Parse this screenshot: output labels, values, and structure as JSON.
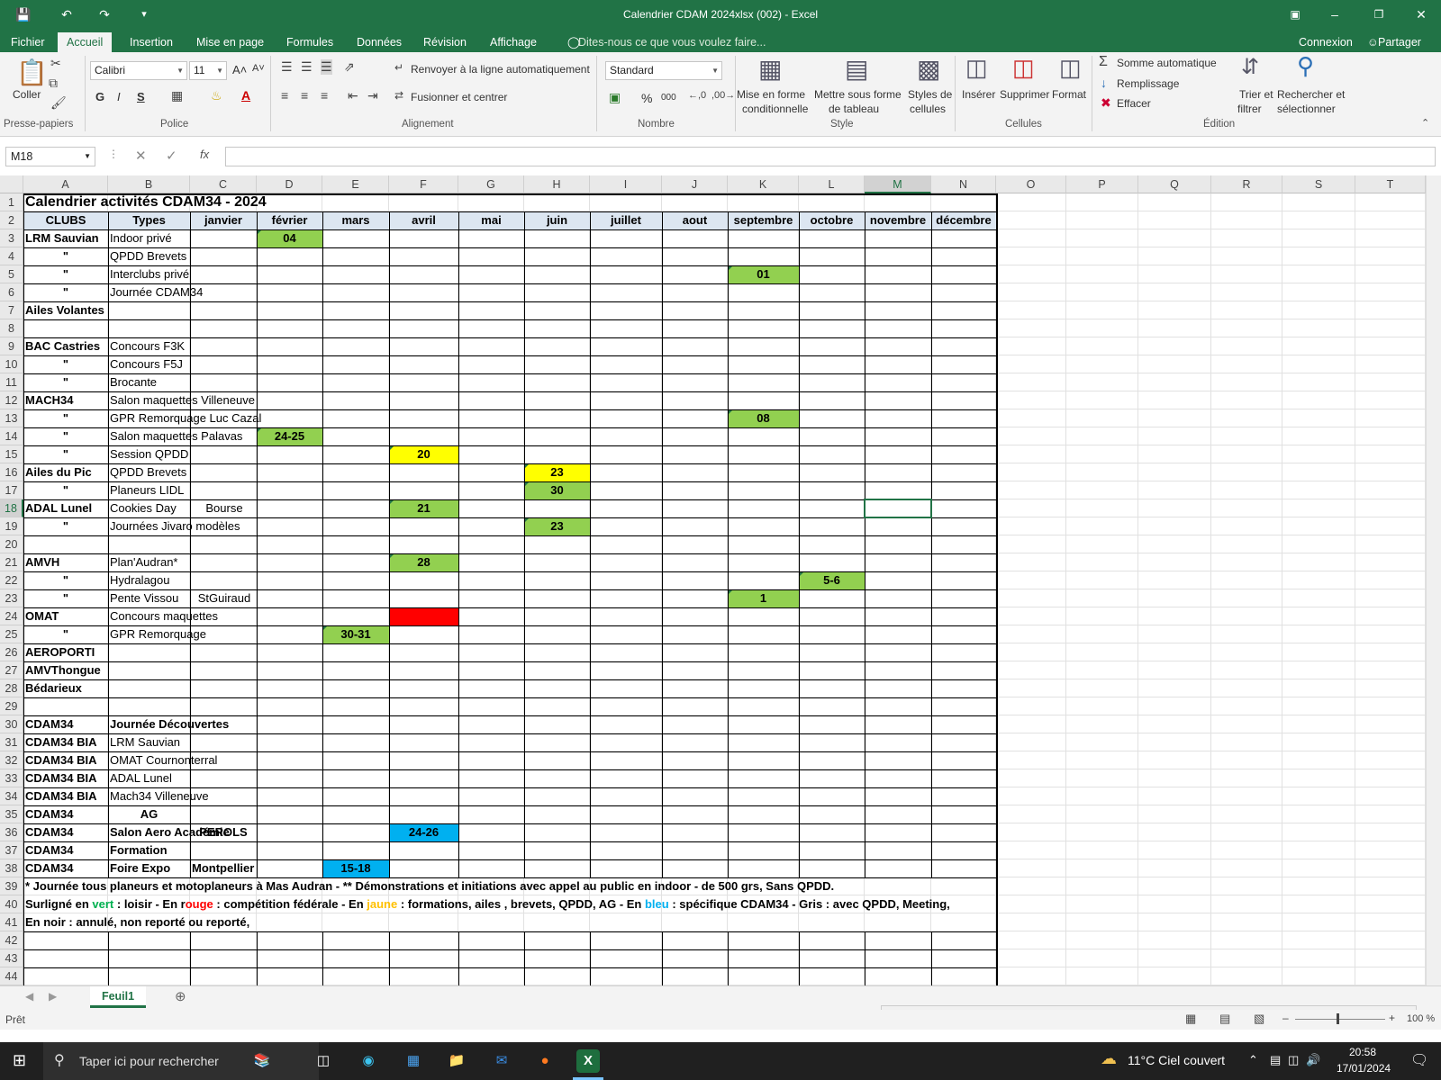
{
  "window": {
    "title": "Calendrier CDAM 2024xlsx (002) - Excel"
  },
  "menu": {
    "file": "Fichier",
    "tabs": [
      "Accueil",
      "Insertion",
      "Mise en page",
      "Formules",
      "Données",
      "Révision",
      "Affichage"
    ],
    "tell_me": "Dites-nous ce que vous voulez faire...",
    "signin": "Connexion",
    "share": "Partager"
  },
  "ribbon": {
    "paste": "Coller",
    "font_name": "Calibri",
    "font_size": "11",
    "bold": "G",
    "italic": "I",
    "underline": "S",
    "wrap": "Renvoyer à la ligne automatiquement",
    "merge": "Fusionner et centrer",
    "number_format": "Standard",
    "percent": "%",
    "thousands": "000",
    "cond_format_1": "Mise en forme",
    "cond_format_2": "conditionnelle",
    "table_1": "Mettre sous forme",
    "table_2": "de tableau",
    "styles_1": "Styles de",
    "styles_2": "cellules",
    "insert": "Insérer",
    "delete": "Supprimer",
    "format": "Format",
    "autosum": "Somme automatique",
    "fill": "Remplissage",
    "clear": "Effacer",
    "sort_1": "Trier et",
    "sort_2": "filtrer",
    "find_1": "Rechercher et",
    "find_2": "sélectionner",
    "groups": [
      "Presse-papiers",
      "Police",
      "Alignement",
      "Nombre",
      "Style",
      "Cellules",
      "Édition"
    ]
  },
  "formula_bar": {
    "name_box": "M18",
    "fx": "fx",
    "value": ""
  },
  "columns": [
    "A",
    "B",
    "C",
    "D",
    "E",
    "F",
    "G",
    "H",
    "I",
    "J",
    "K",
    "L",
    "M",
    "N",
    "O",
    "P",
    "Q",
    "R",
    "S",
    "T"
  ],
  "selected_cell": "M18",
  "sheet": {
    "title": "Calendrier activités CDAM34 - 2024",
    "headers": [
      "CLUBS",
      "Types",
      "janvier",
      "février",
      "mars",
      "avril",
      "mai",
      "juin",
      "juillet",
      "aout",
      "septembre",
      "octobre",
      "novembre",
      "décembre"
    ],
    "rows": [
      {
        "r": 3,
        "a": "LRM Sauvian",
        "b": "Indoor privé",
        "marks": [
          {
            "col": "D",
            "text": "04",
            "color": "green"
          }
        ]
      },
      {
        "r": 4,
        "a": "\"",
        "b": "QPDD Brevets",
        "marks": []
      },
      {
        "r": 5,
        "a": "\"",
        "b": "Interclubs privé",
        "marks": [
          {
            "col": "K",
            "text": "01",
            "color": "green"
          }
        ]
      },
      {
        "r": 6,
        "a": "\"",
        "b": "Journée CDAM34",
        "marks": []
      },
      {
        "r": 7,
        "a": "Ailes Volantes",
        "b": "",
        "marks": []
      },
      {
        "r": 8,
        "a": "",
        "b": "",
        "marks": []
      },
      {
        "r": 9,
        "a": "BAC Castries",
        "b": "Concours F3K",
        "marks": []
      },
      {
        "r": 10,
        "a": "\"",
        "b": "Concours F5J",
        "marks": []
      },
      {
        "r": 11,
        "a": "\"",
        "b": "Brocante",
        "marks": []
      },
      {
        "r": 12,
        "a": "MACH34",
        "b": "Salon maquettes Villeneuve",
        "marks": []
      },
      {
        "r": 13,
        "a": "\"",
        "b": "GPR  Remorquage  Luc Cazal",
        "marks": [
          {
            "col": "K",
            "text": "08",
            "color": "green"
          }
        ]
      },
      {
        "r": 14,
        "a": "\"",
        "b": "Salon maquettes Palavas",
        "marks": [
          {
            "col": "D",
            "text": "24-25",
            "color": "green"
          }
        ]
      },
      {
        "r": 15,
        "a": "\"",
        "b": "Session QPDD",
        "marks": [
          {
            "col": "F",
            "text": "20",
            "color": "yellow"
          }
        ]
      },
      {
        "r": 16,
        "a": "Ailes du Pic",
        "b": "QPDD Brevets",
        "marks": [
          {
            "col": "H",
            "text": "23",
            "color": "yellow"
          }
        ]
      },
      {
        "r": 17,
        "a": "\"",
        "b": "Planeurs LIDL",
        "marks": [
          {
            "col": "H",
            "text": "30",
            "color": "green"
          }
        ]
      },
      {
        "r": 18,
        "a": "ADAL Lunel",
        "b": "Cookies Day",
        "c": "Bourse",
        "marks": [
          {
            "col": "F",
            "text": "21",
            "color": "green"
          }
        ]
      },
      {
        "r": 19,
        "a": "\"",
        "b": "Journées Jivaro modèles",
        "marks": [
          {
            "col": "H",
            "text": "23",
            "color": "green"
          }
        ]
      },
      {
        "r": 20,
        "a": "",
        "b": "",
        "marks": []
      },
      {
        "r": 21,
        "a": "AMVH",
        "b": "Plan'Audran*",
        "marks": [
          {
            "col": "F",
            "text": "28",
            "color": "green"
          }
        ]
      },
      {
        "r": 22,
        "a": "\"",
        "b": "Hydralagou",
        "marks": [
          {
            "col": "L",
            "text": "5-6",
            "color": "green"
          }
        ]
      },
      {
        "r": 23,
        "a": "\"",
        "b": "Pente Vissou",
        "c": "StGuiraud",
        "marks": [
          {
            "col": "K",
            "text": "1",
            "color": "green"
          }
        ]
      },
      {
        "r": 24,
        "a": "OMAT",
        "b": "Concours maquettes",
        "marks": [
          {
            "col": "F",
            "text": "",
            "color": "red"
          }
        ]
      },
      {
        "r": 25,
        "a": "\"",
        "b": "GPR Remorquage",
        "marks": [
          {
            "col": "E",
            "text": "30-31",
            "color": "green"
          }
        ]
      },
      {
        "r": 26,
        "a": "AEROPORTI",
        "b": "",
        "marks": []
      },
      {
        "r": 27,
        "a": "AMVThongue",
        "b": "",
        "marks": []
      },
      {
        "r": 28,
        "a": "Bédarieux",
        "b": "",
        "marks": []
      },
      {
        "r": 29,
        "a": "",
        "b": "",
        "marks": []
      },
      {
        "r": 30,
        "a": "CDAM34",
        "b": "Journée Découvertes",
        "bb": true,
        "marks": []
      },
      {
        "r": 31,
        "a": "CDAM34 BIA",
        "b": "LRM Sauvian",
        "marks": []
      },
      {
        "r": 32,
        "a": "CDAM34 BIA",
        "b": "OMAT Cournonterral",
        "marks": []
      },
      {
        "r": 33,
        "a": "CDAM34 BIA",
        "b": "ADAL Lunel",
        "marks": []
      },
      {
        "r": 34,
        "a": "CDAM34 BIA",
        "b": "Mach34 Villeneuve",
        "marks": []
      },
      {
        "r": 35,
        "a": "CDAM34",
        "b": "AG",
        "bb": true,
        "bc": true,
        "marks": []
      },
      {
        "r": 36,
        "a": "CDAM34",
        "b": "Salon Aero Académie",
        "bb": true,
        "c": "PEROLS",
        "cb": true,
        "cc": true,
        "marks": [
          {
            "col": "F",
            "text": "24-26",
            "color": "blue"
          }
        ]
      },
      {
        "r": 37,
        "a": "CDAM34",
        "b": "Formation",
        "bb": true,
        "marks": []
      },
      {
        "r": 38,
        "a": "CDAM34",
        "b": "Foire Expo",
        "bb": true,
        "c": "Montpellier",
        "cb": true,
        "marks": [
          {
            "col": "E",
            "text": "15-18",
            "color": "blue"
          }
        ]
      }
    ],
    "note39": "* Journée tous planeurs et motoplaneurs à Mas Audran  - ** Démonstrations et initiations avec appel au public en indoor - de 500 grs, Sans QPDD.",
    "note40": {
      "p1": "Surligné en ",
      "vert": "vert",
      "p2": " : loisir - En r",
      "rouge": "ouge",
      "p3": " : compétition fédérale -  En ",
      "jaune": "jaune",
      "p4": " : formations, ailes , brevets, QPDD, AG - En ",
      "bleu": "bleu",
      "p5": " : spécifique CDAM34 - Gris : avec QPDD, Meeting,"
    },
    "note41": "En noir : annulé, non reporté ou reporté,",
    "row_numbers": [
      "1",
      "2",
      "3",
      "4",
      "5",
      "6",
      "7",
      "8",
      "9",
      "10",
      "11",
      "12",
      "13",
      "14",
      "15",
      "16",
      "17",
      "18",
      "19",
      "20",
      "21",
      "22",
      "23",
      "24",
      "25",
      "26",
      "27",
      "28",
      "29",
      "30",
      "31",
      "32",
      "33",
      "34",
      "35",
      "36",
      "37",
      "38",
      "39",
      "40",
      "41",
      "42",
      "43",
      "44"
    ]
  },
  "colors": {
    "green": "#92d050",
    "yellow": "#ffff00",
    "red": "#ff0000",
    "blue": "#00b0f0",
    "header_fill": "#dce6f1",
    "excel_green": "#217346"
  },
  "sheet_tab": "Feuil1",
  "status": {
    "ready": "Prêt",
    "zoom": "100 %"
  },
  "taskbar": {
    "search_placeholder": "Taper ici pour rechercher",
    "weather": "11°C  Ciel couvert",
    "time": "20:58",
    "date": "17/01/2024"
  }
}
